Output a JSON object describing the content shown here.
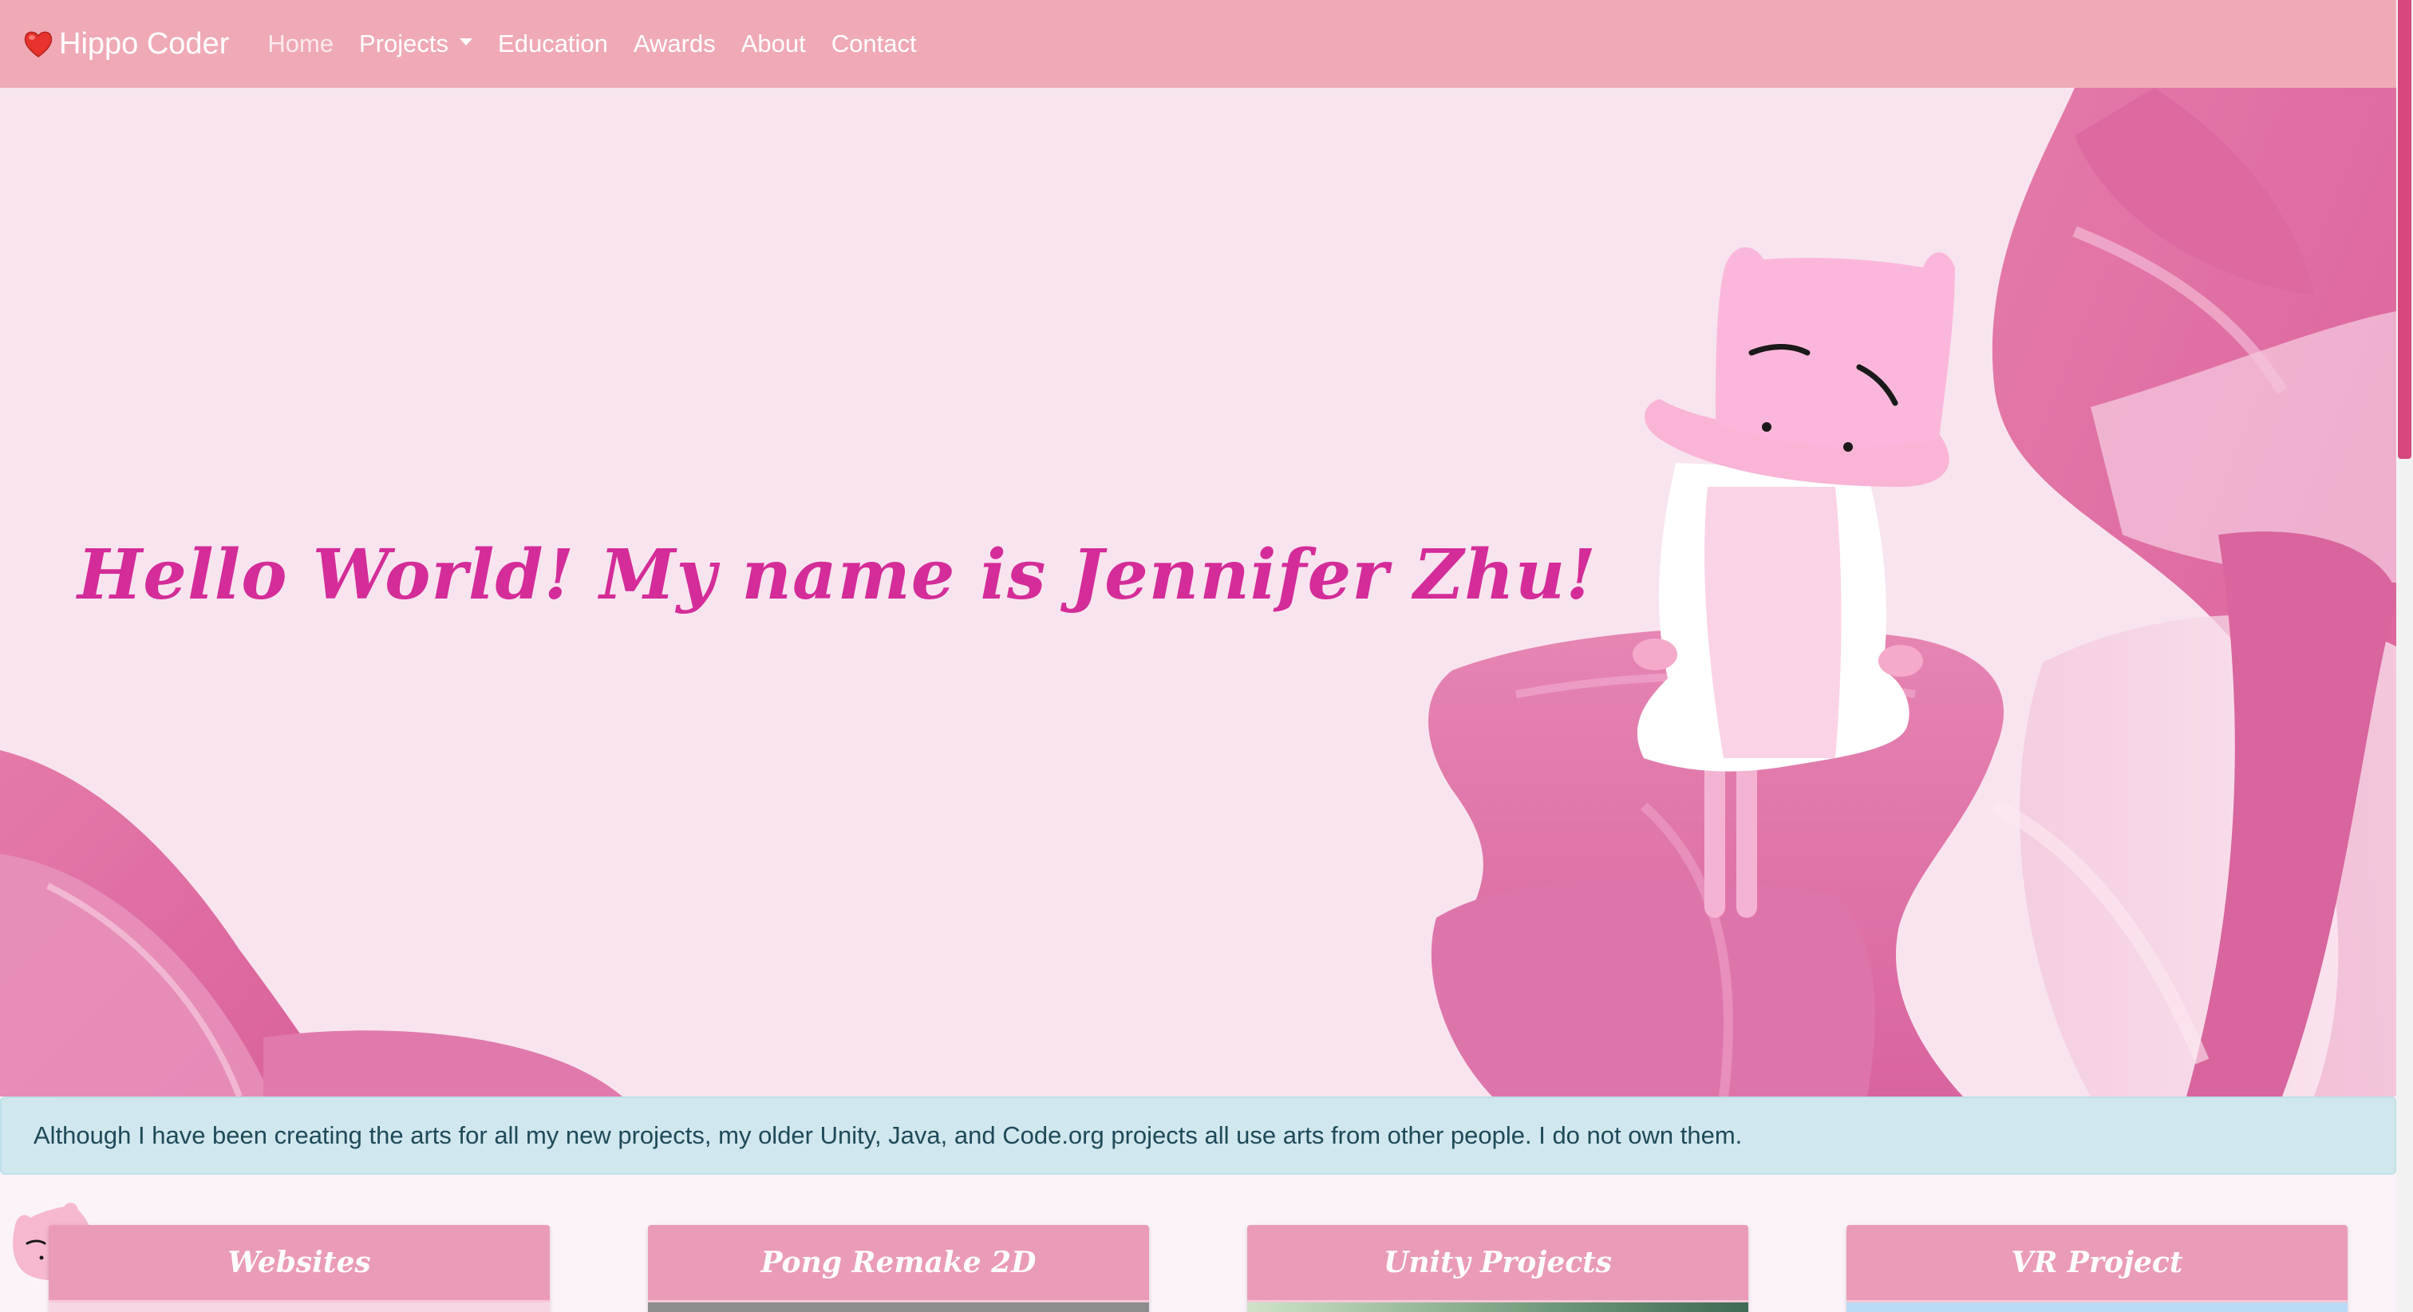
{
  "navbar": {
    "brand_icon": "heart-icon",
    "brand": "Hippo Coder",
    "links": {
      "home": "Home",
      "projects": "Projects",
      "education": "Education",
      "awards": "Awards",
      "about": "About",
      "contact": "Contact"
    }
  },
  "hero": {
    "title": "Hello World! My name is Jennifer Zhu!"
  },
  "alert": {
    "text": "Although I have been creating the arts for all my new projects, my older Unity, Java, and Code.org projects all use arts from other people. I do not own them."
  },
  "cards": [
    {
      "title": "Websites"
    },
    {
      "title": "Pong Remake 2D"
    },
    {
      "title": "Unity Projects"
    },
    {
      "title": "VR Project"
    }
  ],
  "colors": {
    "navbar": "#efaab6",
    "hero_bg": "#f8e4ef",
    "title": "#d42c98",
    "alert_bg": "#d1e7ee",
    "card_header": "#ea9bb8"
  }
}
